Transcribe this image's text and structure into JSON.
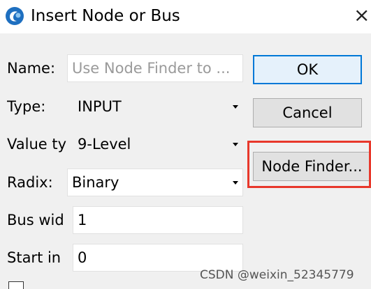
{
  "window": {
    "title": "Insert Node or Bus",
    "close_glyph": "×"
  },
  "form": {
    "name": {
      "label": "Name:",
      "placeholder": "Use Node Finder to ..."
    },
    "type": {
      "label": "Type:",
      "value": "INPUT"
    },
    "value_type": {
      "label": "Value ty",
      "value": "9-Level"
    },
    "radix": {
      "label": "Radix:",
      "value": "Binary"
    },
    "bus_width": {
      "label": "Bus wid",
      "value": "1"
    },
    "start_index": {
      "label": "Start in",
      "value": "0"
    }
  },
  "buttons": {
    "ok": "OK",
    "cancel": "Cancel",
    "node_finder": "Node Finder..."
  },
  "watermark": "CSDN @weixin_52345779",
  "colors": {
    "highlight": "#e8382b",
    "default_button_border": "#0078d7",
    "icon_blue": "#1e6fc0"
  }
}
